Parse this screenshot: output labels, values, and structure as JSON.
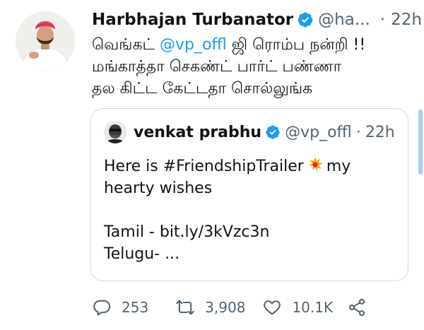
{
  "tweet": {
    "author_name": "Harbhajan Turbanator",
    "handle": "@ha...",
    "separator": "·",
    "time": "22h",
    "text_lines": [
      {
        "before": "வெங்கட் ",
        "mention": "@vp_offl",
        "after": " ஜி ரொம்ப நன்றி !!"
      },
      {
        "text": "மங்காத்தா செகண்ட் பார்ட் பண்ணா"
      },
      {
        "text": "தல கிட்ட கேட்டதா சொல்லுங்க"
      }
    ]
  },
  "quote": {
    "author_name": "venkat prabhu",
    "handle": "@vp_offl",
    "separator": "·",
    "time": "22h",
    "line1_before": "Here is #FriendshipTrailer",
    "line1_after": "my",
    "line2": "hearty wishes",
    "line3": "",
    "line4": "Tamil - bit.ly/3kVzc3n",
    "line5": "Telugu-  ..."
  },
  "actions": {
    "reply_count": "253",
    "retweet_count": "3,908",
    "like_count": "10.1K"
  },
  "colors": {
    "accent": "#1d9bf0",
    "secondary_text": "#536471",
    "border": "#cfd9de"
  }
}
